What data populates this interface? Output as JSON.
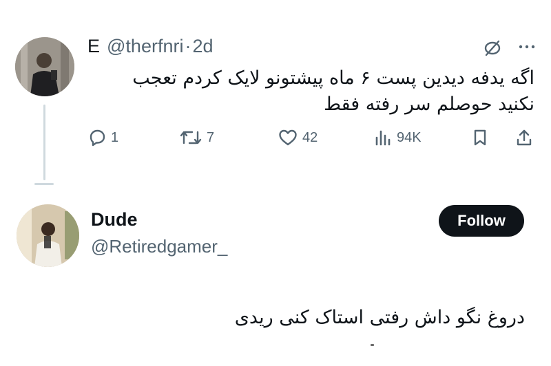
{
  "parent_tweet": {
    "name": "E",
    "handle": "@therfnri",
    "separator": "·",
    "time": "2d",
    "text_line1": "اگه یدفه دیدین پست ۶ ماه پیشتونو لایک کردم تعجب",
    "text_line2": "نکنید حوصلم سر رفته فقط",
    "actions": {
      "replies": "1",
      "retweets": "7",
      "likes": "42",
      "views": "94K"
    },
    "more_label": "···"
  },
  "reply_tweet": {
    "name": "Dude",
    "handle": "@Retiredgamer_",
    "follow_label": "Follow",
    "text": "دروغ نگو داش رفتی استاک کنی ریدی"
  },
  "icons": {
    "reply": "reply-icon",
    "retweet": "retweet-icon",
    "like": "heart-icon",
    "views": "views-icon",
    "bookmark": "bookmark-icon",
    "share": "share-icon",
    "hide": "hide-icon",
    "more": "more-icon"
  },
  "colors": {
    "text_primary": "#0f1419",
    "text_secondary": "#536471",
    "thread_line": "#cfd9de",
    "follow_button_bg": "#0f1419",
    "follow_button_text": "#ffffff"
  }
}
